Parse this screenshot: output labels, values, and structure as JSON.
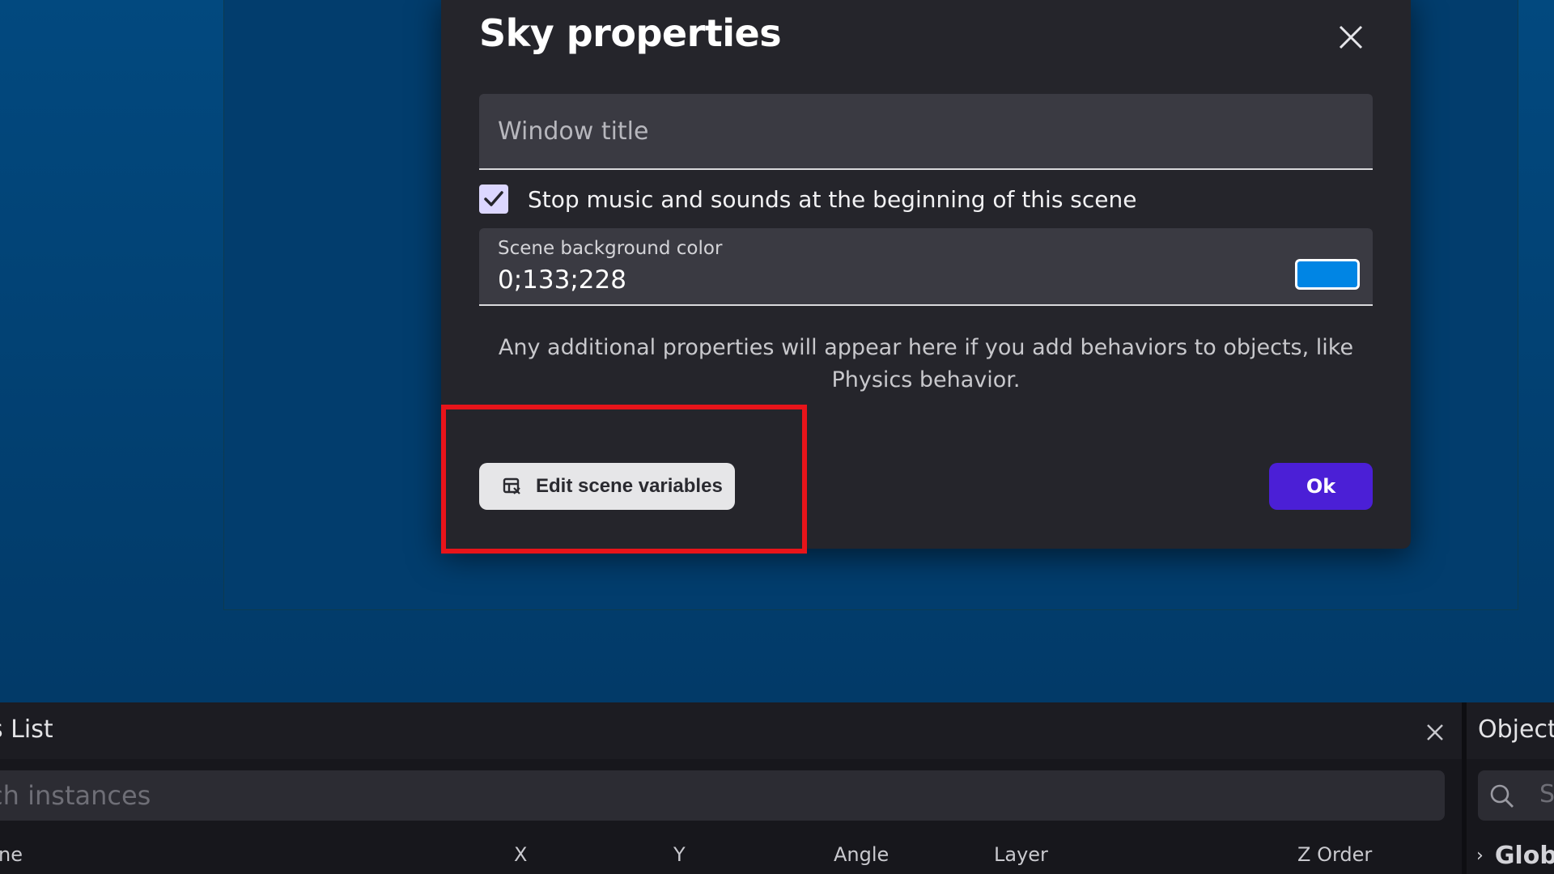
{
  "dialog": {
    "title": "Sky properties",
    "window_title_placeholder": "Window title",
    "checkbox_label": "Stop music and sounds at the beginning of this scene",
    "checkbox_checked": true,
    "bg_color_label": "Scene background color",
    "bg_color_value": "0;133;228",
    "bg_color_hex": "#0085e4",
    "helper_text": "Any additional properties will appear here if you add behaviors to objects, like Physics behavior.",
    "edit_vars_label": "Edit scene variables",
    "ok_label": "Ok"
  },
  "instances_panel": {
    "title": "s List",
    "search_placeholder": "arch instances",
    "columns": [
      "ne",
      "X",
      "Y",
      "Angle",
      "Layer",
      "Z Order"
    ]
  },
  "objects_panel": {
    "title": "Object",
    "search_placeholder": "S",
    "globals_label": "Glob"
  },
  "colors": {
    "accent": "#4b1fd6",
    "highlight": "#e8141a",
    "scene_bg": "#02497d"
  }
}
